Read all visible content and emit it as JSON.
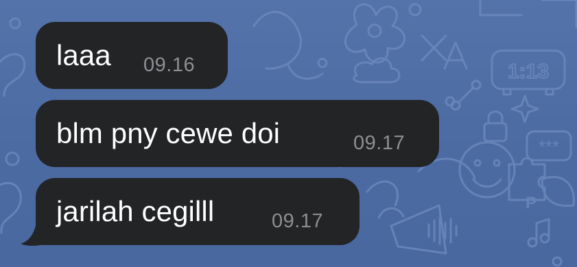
{
  "chat": {
    "messages": [
      {
        "text": "laaa",
        "time": "09.16"
      },
      {
        "text": "blm pny cewe doi",
        "time": "09.17"
      },
      {
        "text": "jarilah cegilll",
        "time": "09.17"
      }
    ]
  },
  "background": {
    "clock_badge": "1:13",
    "password_badge": "***",
    "letter_a": "A",
    "letter_p": "P"
  },
  "colors": {
    "background": "#4f6fa6",
    "bubble": "#232426",
    "message_text": "#ffffff",
    "timestamp": "#8e8f92",
    "doodle": "#6f8cc0"
  }
}
